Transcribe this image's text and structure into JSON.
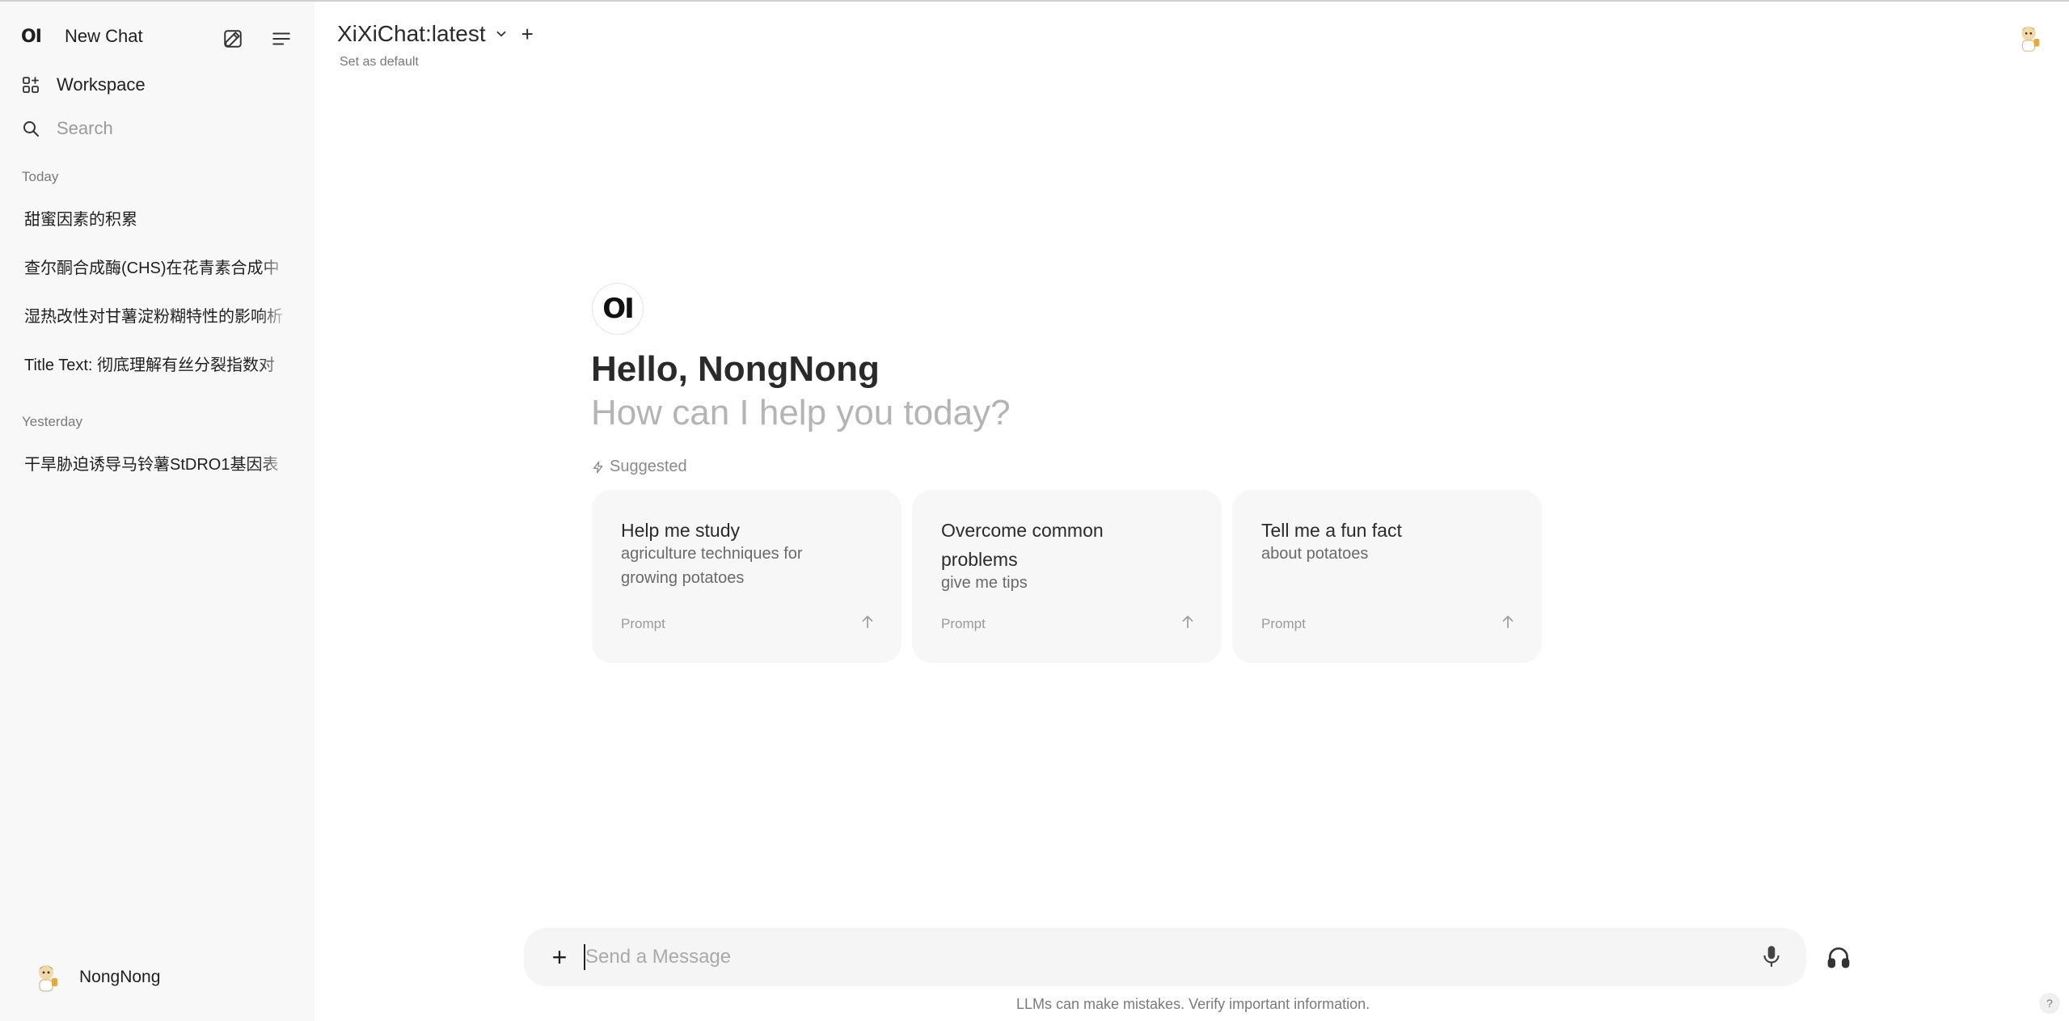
{
  "sidebar": {
    "new_chat_logo": "OI",
    "new_chat_label": "New Chat",
    "workspace_label": "Workspace",
    "search_placeholder": "Search",
    "sections": [
      {
        "title": "Today",
        "items": [
          "甜蜜因素的积累",
          "查尔酮合成酶(CHS)在花青素合成中",
          "湿热改性对甘薯淀粉糊特性的影响析",
          "Title Text: 彻底理解有丝分裂指数对"
        ]
      },
      {
        "title": "Yesterday",
        "items": [
          "干旱胁迫诱导马铃薯StDRO1基因表"
        ]
      }
    ],
    "user_name": "NongNong"
  },
  "header": {
    "model_name": "XiXiChat:latest",
    "set_default": "Set as default",
    "add_model": "+"
  },
  "main": {
    "logo": "OI",
    "greeting": "Hello, NongNong",
    "subtitle": "How can I help you today?",
    "suggested_label": "Suggested",
    "cards": [
      {
        "title": "Help me study",
        "subtitle": "agriculture techniques for growing potatoes",
        "tag": "Prompt"
      },
      {
        "title": "Overcome common problems",
        "subtitle": "give me tips",
        "tag": "Prompt"
      },
      {
        "title": "Tell me a fun fact",
        "subtitle": "about potatoes",
        "tag": "Prompt"
      }
    ]
  },
  "composer": {
    "placeholder": "Send a Message",
    "add": "+"
  },
  "footer": {
    "disclaimer": "LLMs can make mistakes. Verify important information.",
    "help": "?"
  },
  "icons": {
    "edit": "edit-icon",
    "menu": "menu-icon",
    "workspace": "grid-plus-icon",
    "search": "search-icon",
    "chevron": "chevron-down-icon",
    "mic": "mic-icon",
    "headphones": "headphones-icon",
    "arrow": "arrow-up-icon",
    "bolt": "bolt-icon"
  }
}
